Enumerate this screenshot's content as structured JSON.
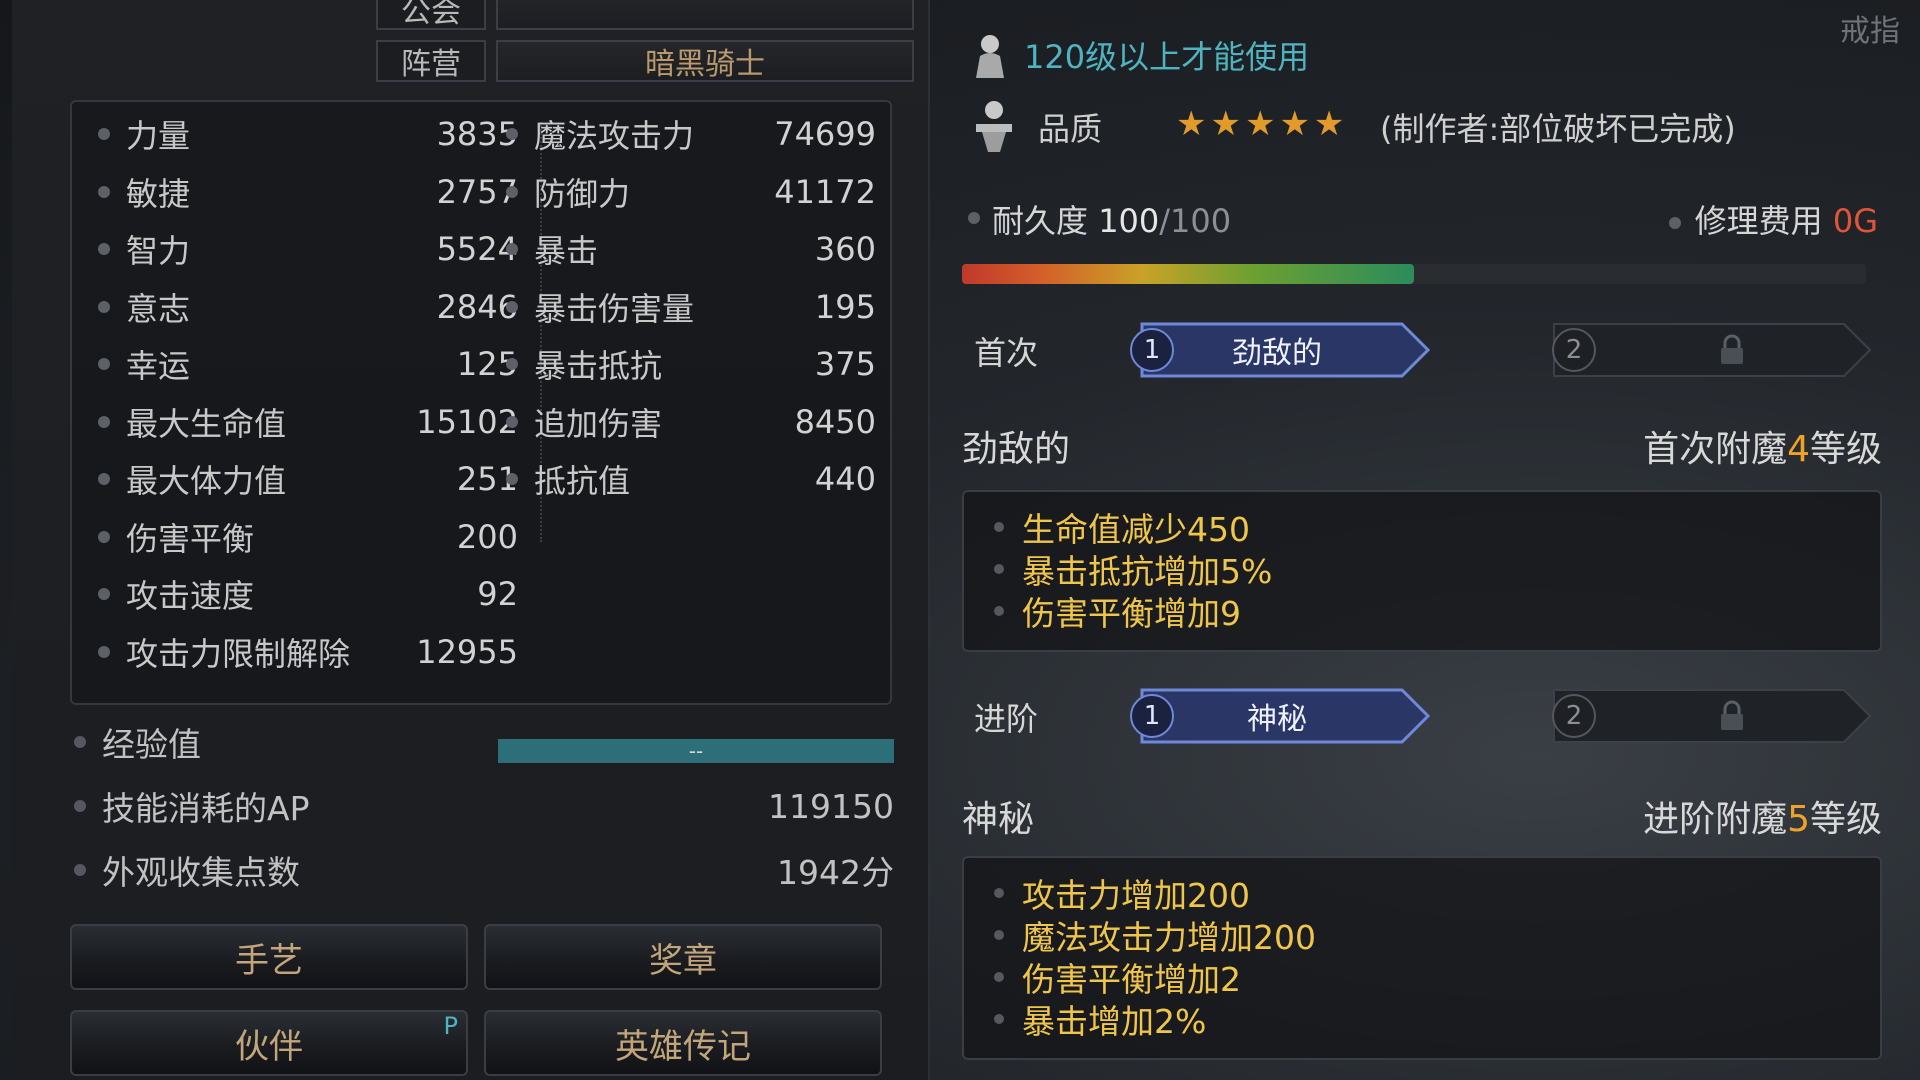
{
  "left": {
    "guild_label": "公会",
    "faction_label": "阵营",
    "faction_value": "暗黑骑士",
    "stats_left": [
      {
        "name": "力量",
        "value": "3835"
      },
      {
        "name": "敏捷",
        "value": "2757"
      },
      {
        "name": "智力",
        "value": "5524"
      },
      {
        "name": "意志",
        "value": "2846"
      },
      {
        "name": "幸运",
        "value": "125"
      },
      {
        "name": "最大生命值",
        "value": "15102"
      },
      {
        "name": "最大体力值",
        "value": "251"
      },
      {
        "name": "伤害平衡",
        "value": "200"
      },
      {
        "name": "攻击速度",
        "value": "92"
      },
      {
        "name": "攻击力限制解除",
        "value": "12955"
      }
    ],
    "stats_right": [
      {
        "name": "魔法攻击力",
        "value": "74699"
      },
      {
        "name": "防御力",
        "value": "41172"
      },
      {
        "name": "暴击",
        "value": "360"
      },
      {
        "name": "暴击伤害量",
        "value": "195"
      },
      {
        "name": "暴击抵抗",
        "value": "375"
      },
      {
        "name": "追加伤害",
        "value": "8450"
      },
      {
        "name": "抵抗值",
        "value": "440"
      }
    ],
    "exp_label": "经验值",
    "exp_value": "--",
    "ap_label": "技能消耗的AP",
    "ap_value": "119150",
    "appearance_label": "外观收集点数",
    "appearance_value": "1942分",
    "buttons": {
      "craft": "手艺",
      "medal": "奖章",
      "partner": "伙伴",
      "partner_badge": "P",
      "hero": "英雄传记"
    }
  },
  "right": {
    "requirement": "120级以上才能使用",
    "quality_label": "品质",
    "stars": "★★★★★",
    "quality_note": "(制作者:部位破坏已完成)",
    "durability_label": "耐久度",
    "durability_current": "100",
    "durability_max": "/100",
    "durability_fraction": 0.5,
    "repair_label": "修理费用",
    "repair_value": "0G",
    "corner_text": "戒指",
    "tier1": {
      "label": "首次",
      "slot1_num": "1",
      "slot1_name": "劲敌的",
      "slot2_num": "2",
      "title": "劲敌的",
      "level_prefix": "首次附魔",
      "level_num": "4",
      "level_suffix": "等级",
      "effects": [
        "生命值减少450",
        "暴击抵抗增加5%",
        "伤害平衡增加9"
      ]
    },
    "tier2": {
      "label": "进阶",
      "slot1_num": "1",
      "slot1_name": "神秘",
      "slot2_num": "2",
      "title": "神秘",
      "level_prefix": "进阶附魔",
      "level_num": "5",
      "level_suffix": "等级",
      "effects": [
        "攻击力增加200",
        "魔法攻击力增加200",
        "伤害平衡增加2",
        "暴击增加2%"
      ]
    }
  }
}
